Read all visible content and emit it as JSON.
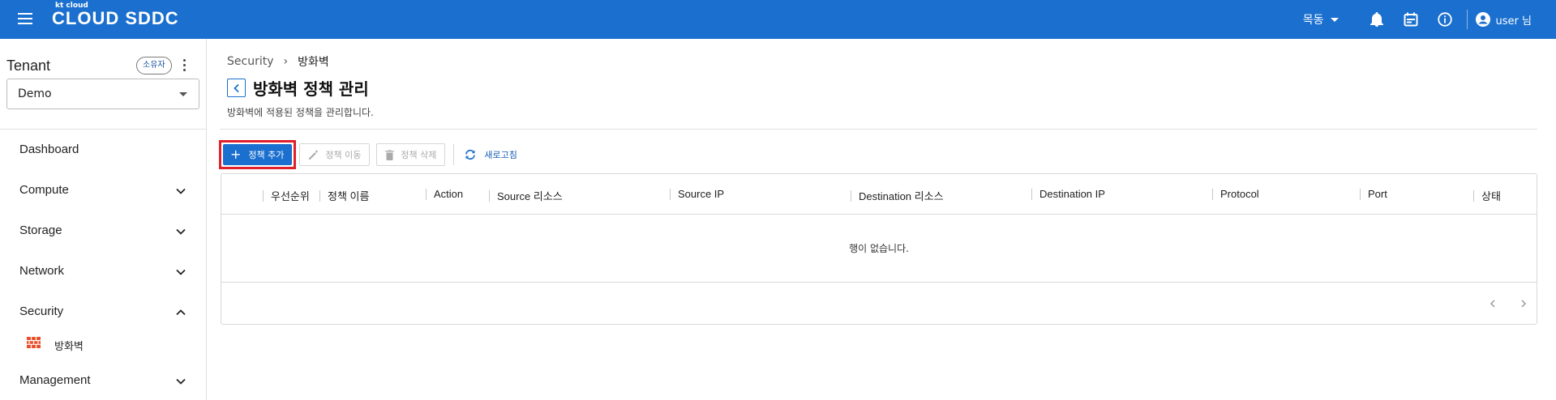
{
  "header": {
    "logo_small": "kt cloud",
    "logo_main": "CLOUD SDDC",
    "region": "목동",
    "user": "user 님",
    "icons": [
      "menu-icon",
      "bell-icon",
      "calendar-icon",
      "info-icon",
      "account-icon"
    ]
  },
  "sidebar": {
    "tenant_title": "Tenant",
    "owner_badge": "소유자",
    "tenant_value": "Demo",
    "items": [
      {
        "label": "Dashboard"
      },
      {
        "label": "Compute"
      },
      {
        "label": "Storage"
      },
      {
        "label": "Network"
      },
      {
        "label": "Security"
      },
      {
        "label": "Management"
      }
    ],
    "sub_items": [
      {
        "label": "방화벽",
        "icon": "firewall-icon"
      }
    ]
  },
  "breadcrumb": {
    "parent": "Security",
    "current": "방화벽"
  },
  "page": {
    "title": "방화벽 정책 관리",
    "description": "방화벽에 적용된 정책을 관리합니다."
  },
  "toolbar": {
    "add": "정책 추가",
    "move": "정책 이동",
    "delete": "정책 삭제",
    "refresh": "새로고침"
  },
  "table": {
    "columns": [
      "우선순위",
      "정책 이름",
      "Action",
      "Source 리소스",
      "Source IP",
      "Destination 리소스",
      "Destination IP",
      "Protocol",
      "Port",
      "상태"
    ],
    "empty_text": "행이 없습니다."
  },
  "colors": {
    "primary": "#1a6fcf",
    "highlight": "#e0202a"
  }
}
